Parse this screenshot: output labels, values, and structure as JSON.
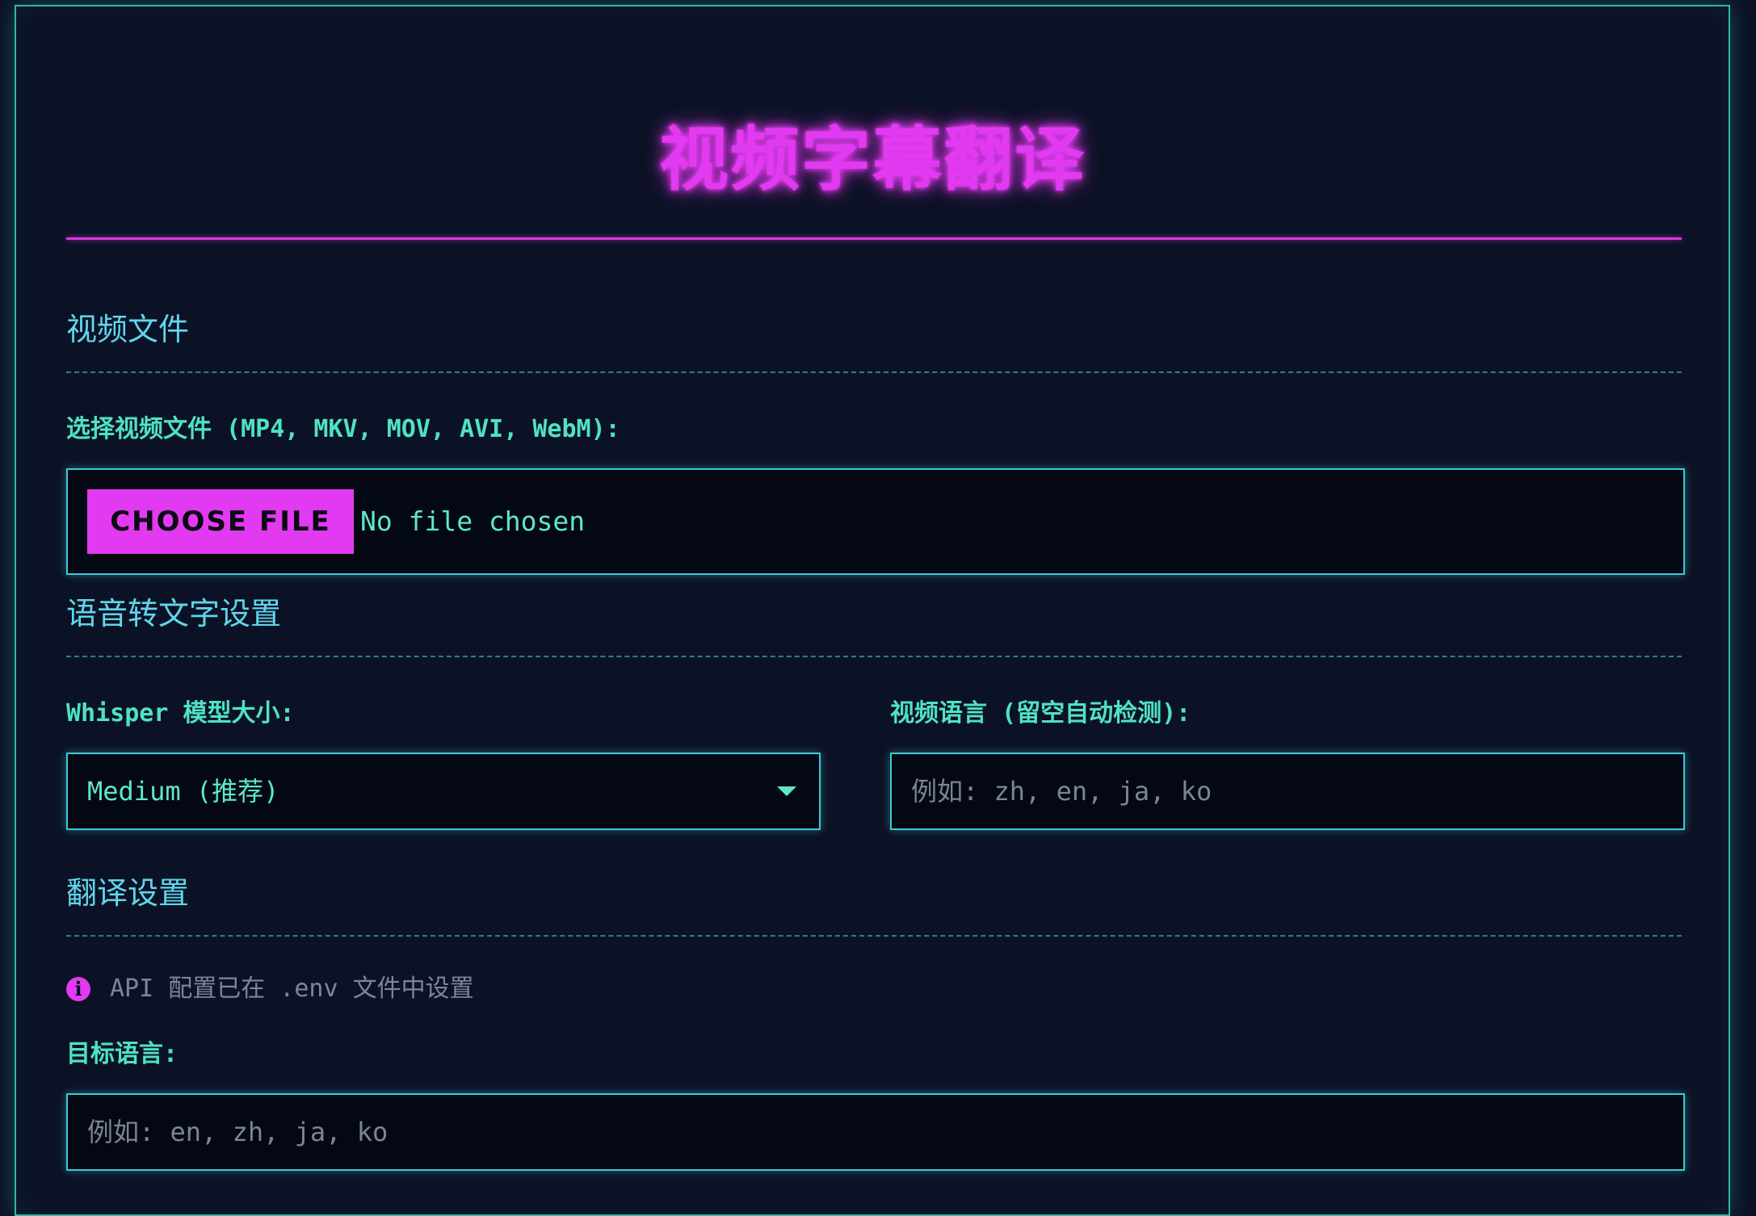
{
  "app": {
    "title": "视频字幕翻译"
  },
  "sections": {
    "video": {
      "title": "视频文件",
      "file_label": "选择视频文件 (MP4, MKV, MOV, AVI, WebM):",
      "choose_button": "CHOOSE FILE",
      "file_status": "No file chosen"
    },
    "speech": {
      "title": "语音转文字设置",
      "model_label": "Whisper 模型大小:",
      "model_selected": "Medium (推荐)",
      "language_label": "视频语言 (留空自动检测):",
      "language_placeholder": "例如: zh, en, ja, ko"
    },
    "translation": {
      "title": "翻译设置",
      "info_icon": "info-icon",
      "info_text": "API 配置已在 .env 文件中设置",
      "target_label": "目标语言:",
      "target_placeholder": "例如: en, zh, ja, ko"
    }
  },
  "colors": {
    "accent_magenta": "#e13af0",
    "accent_cyan": "#3bc9d6",
    "label_green": "#4fe2c3",
    "section_blue": "#5fd6ec",
    "background": "#0b1124"
  }
}
